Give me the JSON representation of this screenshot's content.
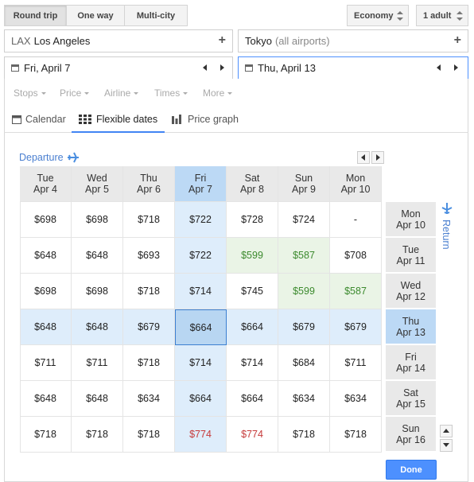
{
  "trip_types": [
    "Round trip",
    "One way",
    "Multi-city"
  ],
  "cabin": "Economy",
  "passengers": "1 adult",
  "origin": {
    "code": "LAX",
    "name": "Los Angeles"
  },
  "destination": {
    "name": "Tokyo",
    "note": "(all airports)"
  },
  "depart_date": "Fri, April 7",
  "return_date": "Thu, April 13",
  "filters": [
    "Stops",
    "Price",
    "Airline",
    "Times",
    "More"
  ],
  "tabs": [
    "Calendar",
    "Flexible dates",
    "Price graph"
  ],
  "departure_label": "Departure",
  "return_label": "Return",
  "dep_days": [
    {
      "dow": "Tue",
      "date": "Apr 4"
    },
    {
      "dow": "Wed",
      "date": "Apr 5"
    },
    {
      "dow": "Thu",
      "date": "Apr 6"
    },
    {
      "dow": "Fri",
      "date": "Apr 7"
    },
    {
      "dow": "Sat",
      "date": "Apr 8"
    },
    {
      "dow": "Sun",
      "date": "Apr 9"
    },
    {
      "dow": "Mon",
      "date": "Apr 10"
    }
  ],
  "ret_days": [
    {
      "dow": "Mon",
      "date": "Apr 10"
    },
    {
      "dow": "Tue",
      "date": "Apr 11"
    },
    {
      "dow": "Wed",
      "date": "Apr 12"
    },
    {
      "dow": "Thu",
      "date": "Apr 13"
    },
    {
      "dow": "Fri",
      "date": "Apr 14"
    },
    {
      "dow": "Sat",
      "date": "Apr 15"
    },
    {
      "dow": "Sun",
      "date": "Apr 16"
    }
  ],
  "prices": [
    [
      "$698",
      "$698",
      "$718",
      "$722",
      "$728",
      "$724",
      "-"
    ],
    [
      "$648",
      "$648",
      "$693",
      "$722",
      "$599",
      "$587",
      "$708"
    ],
    [
      "$698",
      "$698",
      "$718",
      "$714",
      "$745",
      "$599",
      "$587"
    ],
    [
      "$648",
      "$648",
      "$679",
      "$664",
      "$664",
      "$679",
      "$679"
    ],
    [
      "$711",
      "$711",
      "$718",
      "$714",
      "$714",
      "$684",
      "$711"
    ],
    [
      "$648",
      "$648",
      "$634",
      "$664",
      "$664",
      "$634",
      "$634"
    ],
    [
      "$718",
      "$718",
      "$718",
      "$774",
      "$774",
      "$718",
      "$718"
    ]
  ],
  "cheap_cells": [
    [
      1,
      4
    ],
    [
      1,
      5
    ],
    [
      2,
      5
    ],
    [
      2,
      6
    ]
  ],
  "pricey_cells": [
    [
      6,
      3
    ],
    [
      6,
      4
    ]
  ],
  "selected": {
    "dep_index": 3,
    "ret_index": 3
  },
  "done_label": "Done",
  "colors": {
    "accent": "#4285f4",
    "cheap": "#3c8a2e",
    "pricey": "#c63a3a",
    "selected": "#b8d6f2"
  }
}
